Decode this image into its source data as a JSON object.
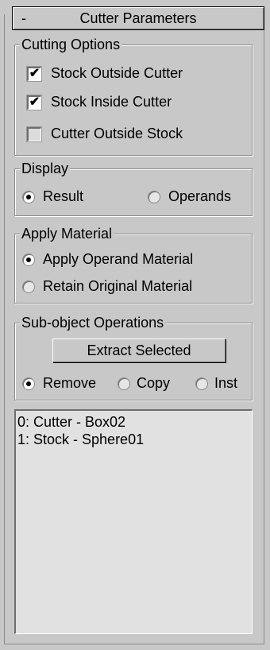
{
  "rollout": {
    "toggle": "-",
    "title": "Cutter Parameters"
  },
  "cutting_options": {
    "label": "Cutting Options",
    "items": [
      {
        "label": "Stock Outside Cutter",
        "checked": true
      },
      {
        "label": "Stock Inside Cutter",
        "checked": true
      },
      {
        "label": "Cutter Outside Stock",
        "checked": false
      }
    ]
  },
  "display": {
    "label": "Display",
    "options": [
      {
        "label": "Result",
        "selected": true
      },
      {
        "label": "Operands",
        "selected": false
      }
    ]
  },
  "apply_material": {
    "label": "Apply Material",
    "options": [
      {
        "label": "Apply Operand Material",
        "selected": true
      },
      {
        "label": "Retain Original Material",
        "selected": false
      }
    ]
  },
  "subobject": {
    "label": "Sub-object Operations",
    "extract_button": "Extract Selected",
    "options": [
      {
        "label": "Remove",
        "selected": true
      },
      {
        "label": "Copy",
        "selected": false
      },
      {
        "label": "Inst",
        "selected": false
      }
    ]
  },
  "operands_list": {
    "items": [
      "0: Cutter - Box02",
      "1: Stock - Sphere01"
    ]
  }
}
